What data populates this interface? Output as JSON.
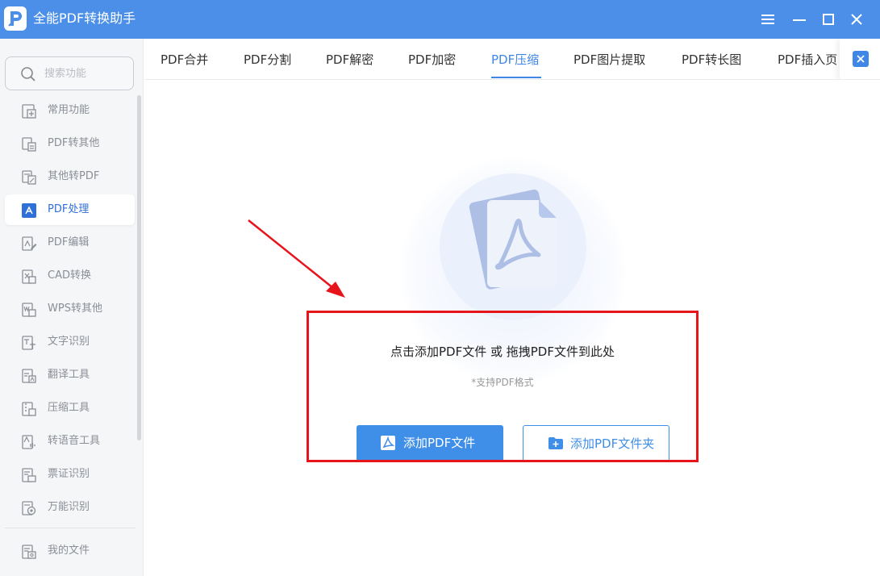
{
  "app": {
    "title": "全能PDF转换助手"
  },
  "colors": {
    "accent": "#3f8ee8",
    "titlebar": "#4b8fe8",
    "highlight": "#e8141b",
    "sidebar_bg": "#f5f6f8"
  },
  "window_controls": [
    {
      "icon": "menu-icon"
    },
    {
      "icon": "minimize-icon"
    },
    {
      "icon": "maximize-icon"
    },
    {
      "icon": "close-icon"
    }
  ],
  "sidebar": {
    "search_placeholder": "搜索功能",
    "items": [
      {
        "label": "常用功能",
        "icon": "common-functions-icon",
        "active": false
      },
      {
        "label": "PDF转其他",
        "icon": "pdf-to-other-icon",
        "active": false
      },
      {
        "label": "其他转PDF",
        "icon": "other-to-pdf-icon",
        "active": false
      },
      {
        "label": "PDF处理",
        "icon": "pdf-process-icon",
        "active": true
      },
      {
        "label": "PDF编辑",
        "icon": "pdf-edit-icon",
        "active": false
      },
      {
        "label": "CAD转换",
        "icon": "cad-convert-icon",
        "active": false
      },
      {
        "label": "WPS转其他",
        "icon": "wps-convert-icon",
        "active": false
      },
      {
        "label": "文字识别",
        "icon": "text-recognition-icon",
        "active": false
      },
      {
        "label": "翻译工具",
        "icon": "translate-icon",
        "active": false
      },
      {
        "label": "压缩工具",
        "icon": "compress-icon",
        "active": false
      },
      {
        "label": "转语音工具",
        "icon": "text-to-speech-icon",
        "active": false
      },
      {
        "label": "票证识别",
        "icon": "ticket-recognition-icon",
        "active": false
      },
      {
        "label": "万能识别",
        "icon": "universal-recognition-icon",
        "active": false
      }
    ],
    "footer_item": {
      "label": "我的文件",
      "icon": "my-files-icon"
    }
  },
  "tabs": [
    {
      "label": "PDF合并",
      "active": false
    },
    {
      "label": "PDF分割",
      "active": false
    },
    {
      "label": "PDF解密",
      "active": false
    },
    {
      "label": "PDF加密",
      "active": false
    },
    {
      "label": "PDF压缩",
      "active": true
    },
    {
      "label": "PDF图片提取",
      "active": false
    },
    {
      "label": "PDF转长图",
      "active": false
    },
    {
      "label": "PDF插入页",
      "active": false
    }
  ],
  "dropzone": {
    "hint": "点击添加PDF文件 或 拖拽PDF文件到此处",
    "sub_hint": "*支持PDF格式",
    "add_file_label": "添加PDF文件",
    "add_folder_label": "添加PDF文件夹"
  }
}
